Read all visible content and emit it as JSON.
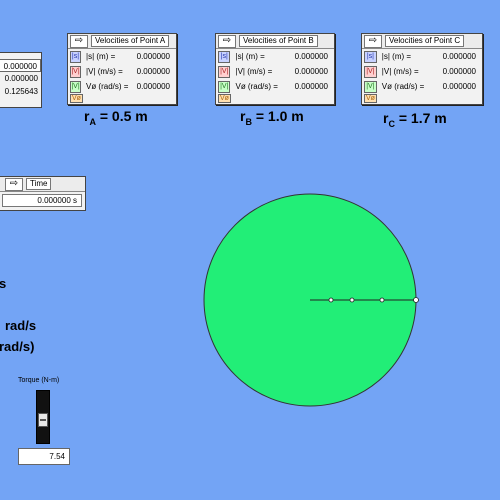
{
  "left_panel": {
    "values": [
      "0.000000",
      "0.000000",
      "0.125643"
    ]
  },
  "velocity_panels": [
    {
      "title": "Velocities of Point A",
      "rows": [
        {
          "icon": "lvl-icon",
          "label": "|s| (m) =",
          "value": "0.000000"
        },
        {
          "icon": "lvl-icon",
          "label": "|V| (m/s) =",
          "value": "0.000000"
        },
        {
          "icon": "lvl-icon",
          "label": "Vø (rad/s) =",
          "value": "0.000000"
        }
      ],
      "radius_symbol": "r",
      "radius_sub": "A",
      "radius_value": "= 0.5 m"
    },
    {
      "title": "Velocities of Point B",
      "rows": [
        {
          "icon": "lvl-icon",
          "label": "|s| (m) =",
          "value": "0.000000"
        },
        {
          "icon": "lvl-icon",
          "label": "|V| (m/s) =",
          "value": "0.000000"
        },
        {
          "icon": "lvl-icon",
          "label": "Vø (rad/s) =",
          "value": "0.000000"
        }
      ],
      "radius_symbol": "r",
      "radius_sub": "B",
      "radius_value": "= 1.0 m"
    },
    {
      "title": "Velocities of Point C",
      "rows": [
        {
          "icon": "lvl-icon",
          "label": "|s| (m) =",
          "value": "0.000000"
        },
        {
          "icon": "lvl-icon",
          "label": "|V| (m/s) =",
          "value": "0.000000"
        },
        {
          "icon": "lvl-icon",
          "label": "Vø (rad/s) =",
          "value": "0.000000"
        }
      ],
      "radius_symbol": "r",
      "radius_sub": "C",
      "radius_value": "= 1.7 m"
    }
  ],
  "time_panel": {
    "title": "Time",
    "value": "0.000000 s"
  },
  "side_text": {
    "line1": "s",
    "line2": "rad/s",
    "line3": "rad/s)"
  },
  "torque": {
    "label": "Torque (N-m)",
    "value": "7.54",
    "level": 0.5
  },
  "colors": {
    "background": "#73a4f5",
    "disk": "#22ee77",
    "swatch_s": "#2233aa",
    "swatch_v": "#aa2222",
    "swatch_vphi": "#227722",
    "swatch_ve": "#aa6611"
  },
  "swatch_labels": [
    "|s|",
    "|V|",
    "|V|",
    "Vø"
  ],
  "icons": {
    "arrow": "right-arrow-icon"
  }
}
